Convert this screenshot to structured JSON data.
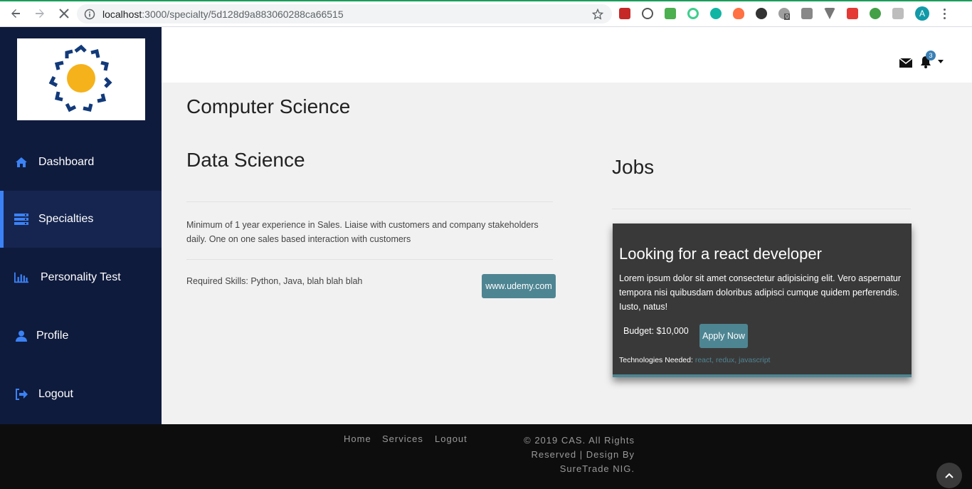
{
  "browser": {
    "url_host": "localhost",
    "url_path": ":3000/specialty/5d128d9a883060288ca66515",
    "profile_initial": "A",
    "extension_badge_count": "0"
  },
  "sidebar": {
    "items": [
      {
        "label": "Dashboard",
        "icon": "home-icon"
      },
      {
        "label": "Specialties",
        "icon": "server-icon"
      },
      {
        "label": "Personality Test",
        "icon": "bar-chart-icon"
      },
      {
        "label": "Profile",
        "icon": "user-icon"
      },
      {
        "label": "Logout",
        "icon": "sign-out-icon"
      }
    ],
    "active_index": 1
  },
  "header": {
    "notification_count": "3"
  },
  "main": {
    "specialty_title": "Computer Science",
    "course_title": "Data Science",
    "course_description": "Minimum of 1 year experience in Sales. Liaise with customers and company stakeholders daily. One on one sales based interaction with customers",
    "required_skills": "Required Skills: Python, Java, blah blah blah",
    "course_link_label": "www.udemy.com",
    "jobs_title": "Jobs",
    "job": {
      "title": "Looking for a react developer",
      "description": "Lorem ipsum dolor sit amet consectetur adipisicing elit. Vero aspernatur tempora nisi quibusdam doloribus adipisci cumque quidem perferendis. Iusto, natus!",
      "budget": "Budget: $10,000",
      "apply_label": "Apply Now",
      "tech_label": "Technologies Needed:",
      "tech_values": "react, redux, javascript"
    }
  },
  "footer": {
    "links": [
      "Home",
      "Services",
      "Logout"
    ],
    "copyright": "© 2019 CAS. All Rights Reserved | Design By SureTrade NIG."
  },
  "colors": {
    "sidebar_bg": "#0f1b3d",
    "accent_teal": "#4e8592",
    "active_border": "#3b82f6",
    "card_bg": "#3a3939"
  }
}
